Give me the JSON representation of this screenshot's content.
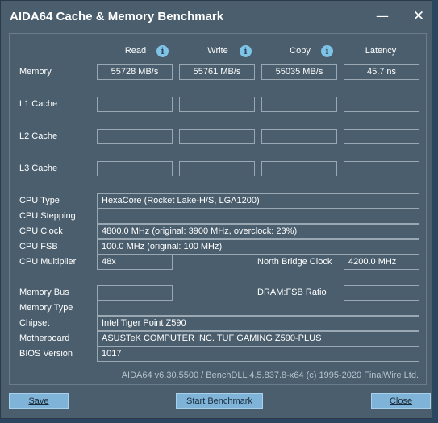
{
  "window": {
    "title": "AIDA64 Cache & Memory Benchmark",
    "minimize_glyph": "—",
    "close_glyph": "✕"
  },
  "columns": {
    "read": "Read",
    "write": "Write",
    "copy": "Copy",
    "latency": "Latency",
    "info_glyph": "i"
  },
  "rows": {
    "memory": {
      "label": "Memory",
      "read": "55728 MB/s",
      "write": "55761 MB/s",
      "copy": "55035 MB/s",
      "latency": "45.7 ns"
    },
    "l1": {
      "label": "L1 Cache",
      "read": "",
      "write": "",
      "copy": "",
      "latency": ""
    },
    "l2": {
      "label": "L2 Cache",
      "read": "",
      "write": "",
      "copy": "",
      "latency": ""
    },
    "l3": {
      "label": "L3 Cache",
      "read": "",
      "write": "",
      "copy": "",
      "latency": ""
    }
  },
  "cpu": {
    "type_label": "CPU Type",
    "type_value": "HexaCore  (Rocket Lake-H/S, LGA1200)",
    "stepping_label": "CPU Stepping",
    "stepping_value": "",
    "clock_label": "CPU Clock",
    "clock_value": "4800.0 MHz  (original: 3900 MHz, overclock: 23%)",
    "fsb_label": "CPU FSB",
    "fsb_value": "100.0 MHz  (original: 100 MHz)",
    "multiplier_label": "CPU Multiplier",
    "multiplier_value": "48x",
    "nb_clock_label": "North Bridge Clock",
    "nb_clock_value": "4200.0 MHz"
  },
  "memory_info": {
    "bus_label": "Memory Bus",
    "bus_value": "",
    "ratio_label": "DRAM:FSB Ratio",
    "ratio_value": "",
    "type_label": "Memory Type",
    "type_value": "",
    "chipset_label": "Chipset",
    "chipset_value": "Intel Tiger Point Z590",
    "motherboard_label": "Motherboard",
    "motherboard_value": "ASUSTeK COMPUTER INC. TUF GAMING Z590-PLUS",
    "bios_label": "BIOS Version",
    "bios_value": "1017"
  },
  "footer": "AIDA64 v6.30.5500 / BenchDLL 4.5.837.8-x64  (c) 1995-2020 FinalWire Ltd.",
  "buttons": {
    "save": "Save",
    "start": "Start Benchmark",
    "close": "Close"
  }
}
